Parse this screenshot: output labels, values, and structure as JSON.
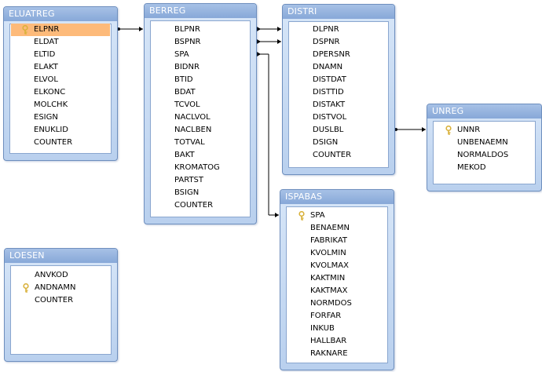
{
  "tables": [
    {
      "id": "eluatreg",
      "title": "ELUATREG",
      "fields": [
        {
          "name": "ELPNR",
          "key": true,
          "selected": true
        },
        {
          "name": "ELDAT"
        },
        {
          "name": "ELTID"
        },
        {
          "name": "ELAKT"
        },
        {
          "name": "ELVOL"
        },
        {
          "name": "ELKONC"
        },
        {
          "name": "MOLCHK"
        },
        {
          "name": "ESIGN"
        },
        {
          "name": "ENUKLID"
        },
        {
          "name": "COUNTER"
        }
      ]
    },
    {
      "id": "berreg",
      "title": "BERREG",
      "fields": [
        {
          "name": "BLPNR"
        },
        {
          "name": "BSPNR"
        },
        {
          "name": "SPA"
        },
        {
          "name": "BIDNR"
        },
        {
          "name": "BTID"
        },
        {
          "name": "BDAT"
        },
        {
          "name": "TCVOL"
        },
        {
          "name": "NACLVOL"
        },
        {
          "name": "NACLBEN"
        },
        {
          "name": "TOTVAL"
        },
        {
          "name": "BAKT"
        },
        {
          "name": "KROMATOG"
        },
        {
          "name": "PARTST"
        },
        {
          "name": "BSIGN"
        },
        {
          "name": "COUNTER"
        }
      ]
    },
    {
      "id": "distri",
      "title": "DISTRI",
      "fields": [
        {
          "name": "DLPNR"
        },
        {
          "name": "DSPNR"
        },
        {
          "name": "DPERSNR"
        },
        {
          "name": "DNAMN"
        },
        {
          "name": "DISTDAT"
        },
        {
          "name": "DISTTID"
        },
        {
          "name": "DISTAKT"
        },
        {
          "name": "DISTVOL"
        },
        {
          "name": "DUSLBL"
        },
        {
          "name": "DSIGN"
        },
        {
          "name": "COUNTER"
        }
      ]
    },
    {
      "id": "unreg",
      "title": "UNREG",
      "fields": [
        {
          "name": "UNNR",
          "key": true
        },
        {
          "name": "UNBENAEMN"
        },
        {
          "name": "NORMALDOS"
        },
        {
          "name": "MEKOD"
        }
      ]
    },
    {
      "id": "ispabas",
      "title": "ISPABAS",
      "fields": [
        {
          "name": "SPA",
          "key": true
        },
        {
          "name": "BENAEMN"
        },
        {
          "name": "FABRIKAT"
        },
        {
          "name": "KVOLMIN"
        },
        {
          "name": "KVOLMAX"
        },
        {
          "name": "KAKTMIN"
        },
        {
          "name": "KAKTMAX"
        },
        {
          "name": "NORMDOS"
        },
        {
          "name": "FORFAR"
        },
        {
          "name": "INKUB"
        },
        {
          "name": "HALLBAR"
        },
        {
          "name": "RAKNARE"
        }
      ]
    },
    {
      "id": "loesen",
      "title": "LOESEN",
      "fields": [
        {
          "name": "ANVKOD"
        },
        {
          "name": "ANDNAMN",
          "key": true
        },
        {
          "name": "COUNTER"
        }
      ]
    }
  ],
  "relationships": [
    {
      "from": "eluatreg.ELPNR",
      "to": "berreg.BLPNR",
      "ends": "many-to-one"
    },
    {
      "from": "berreg.BLPNR",
      "to": "distri.DLPNR",
      "ends": "many-to-many"
    },
    {
      "from": "berreg.BSPNR",
      "to": "distri.DSPNR",
      "ends": "many-to-many"
    },
    {
      "from": "berreg.SPA",
      "to": "ispabas.SPA",
      "ends": "many-to-one"
    },
    {
      "from": "distri.DUSLBL",
      "to": "unreg.UNNR",
      "ends": "many-to-one"
    }
  ],
  "colors": {
    "title_text": "#ffffff",
    "frame": "#6e8fbe",
    "selected_row": "#fdba7a",
    "line": "#000000",
    "key_icon": "#d9b13a"
  }
}
